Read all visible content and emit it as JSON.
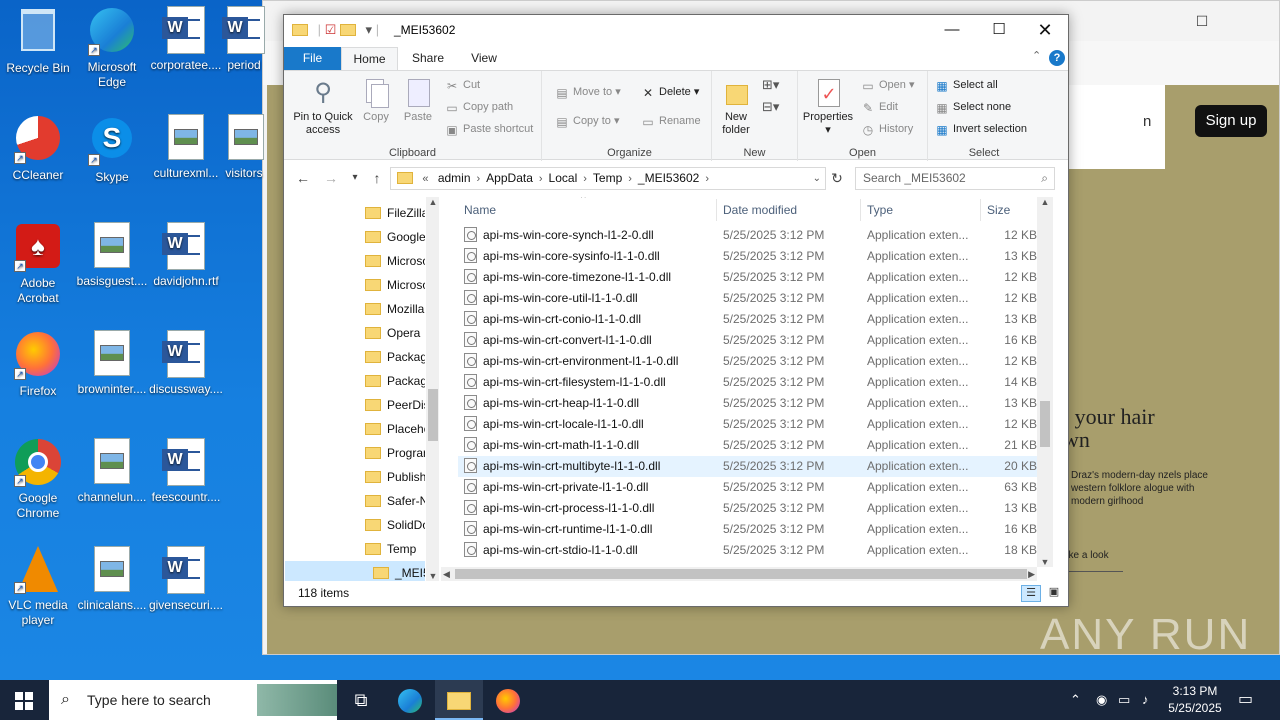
{
  "desktop": {
    "icons": [
      {
        "label": "Recycle Bin",
        "type": "recycle"
      },
      {
        "label": "Microsoft Edge",
        "type": "edge"
      },
      {
        "label": "corporatee....",
        "type": "word"
      },
      {
        "label": "period",
        "type": "word"
      },
      {
        "label": "CCleaner",
        "type": "ccleaner"
      },
      {
        "label": "Skype",
        "type": "skype"
      },
      {
        "label": "culturexml...",
        "type": "image"
      },
      {
        "label": "visitors",
        "type": "image"
      },
      {
        "label": "Adobe Acrobat",
        "type": "acrobat"
      },
      {
        "label": "basisguest....",
        "type": "image"
      },
      {
        "label": "davidjohn.rtf",
        "type": "word"
      },
      {
        "label": "Firefox",
        "type": "firefox"
      },
      {
        "label": "browninter....",
        "type": "image"
      },
      {
        "label": "discussway....",
        "type": "word"
      },
      {
        "label": "Google Chrome",
        "type": "chrome"
      },
      {
        "label": "channelun....",
        "type": "image"
      },
      {
        "label": "feescountr....",
        "type": "word"
      },
      {
        "label": "VLC media player",
        "type": "vlc"
      },
      {
        "label": "clinicalans....",
        "type": "image"
      },
      {
        "label": "givensecuri....",
        "type": "word"
      }
    ]
  },
  "browser": {
    "signup_label": "Sign up",
    "partial_link": "n",
    "hero_title_1": "t your hair",
    "hero_title_2": "wn",
    "hero_sub": "Draz's modern-day nzels place western folklore alogue with modern girlhood",
    "take_look": "ake a look"
  },
  "explorer": {
    "title": "_MEI53602",
    "tabs": {
      "file": "File",
      "home": "Home",
      "share": "Share",
      "view": "View"
    },
    "ribbon": {
      "clipboard": {
        "label": "Clipboard",
        "pin": "Pin to Quick access",
        "copy": "Copy",
        "paste": "Paste",
        "cut": "Cut",
        "copy_path": "Copy path",
        "paste_shortcut": "Paste shortcut"
      },
      "organize": {
        "label": "Organize",
        "move_to": "Move to",
        "copy_to": "Copy to",
        "delete": "Delete",
        "rename": "Rename"
      },
      "new": {
        "label": "New",
        "new_folder": "New folder"
      },
      "open": {
        "label": "Open",
        "properties": "Properties",
        "open": "Open",
        "edit": "Edit",
        "history": "History"
      },
      "select": {
        "label": "Select",
        "select_all": "Select all",
        "select_none": "Select none",
        "invert": "Invert selection"
      }
    },
    "address": {
      "prefix": "«",
      "segments": [
        "admin",
        "AppData",
        "Local",
        "Temp",
        "_MEI53602"
      ]
    },
    "search_placeholder": "Search _MEI53602",
    "nav_items": [
      {
        "label": "FileZilla"
      },
      {
        "label": "Google"
      },
      {
        "label": "Microso"
      },
      {
        "label": "Microso"
      },
      {
        "label": "Mozilla"
      },
      {
        "label": "Opera"
      },
      {
        "label": "Packag"
      },
      {
        "label": "Packag"
      },
      {
        "label": "PeerDis"
      },
      {
        "label": "Placeho"
      },
      {
        "label": "Progran"
      },
      {
        "label": "Publish"
      },
      {
        "label": "Safer-N"
      },
      {
        "label": "SolidDo"
      },
      {
        "label": "Temp"
      },
      {
        "label": "_MEI5"
      }
    ],
    "columns": {
      "name": "Name",
      "date": "Date modified",
      "type": "Type",
      "size": "Size"
    },
    "files": [
      {
        "name": "api-ms-win-core-synch-l1-2-0.dll",
        "date": "5/25/2025 3:12 PM",
        "type": "Application exten...",
        "size": "12 KB"
      },
      {
        "name": "api-ms-win-core-sysinfo-l1-1-0.dll",
        "date": "5/25/2025 3:12 PM",
        "type": "Application exten...",
        "size": "13 KB"
      },
      {
        "name": "api-ms-win-core-timezone-l1-1-0.dll",
        "date": "5/25/2025 3:12 PM",
        "type": "Application exten...",
        "size": "12 KB"
      },
      {
        "name": "api-ms-win-core-util-l1-1-0.dll",
        "date": "5/25/2025 3:12 PM",
        "type": "Application exten...",
        "size": "12 KB"
      },
      {
        "name": "api-ms-win-crt-conio-l1-1-0.dll",
        "date": "5/25/2025 3:12 PM",
        "type": "Application exten...",
        "size": "13 KB"
      },
      {
        "name": "api-ms-win-crt-convert-l1-1-0.dll",
        "date": "5/25/2025 3:12 PM",
        "type": "Application exten...",
        "size": "16 KB"
      },
      {
        "name": "api-ms-win-crt-environment-l1-1-0.dll",
        "date": "5/25/2025 3:12 PM",
        "type": "Application exten...",
        "size": "12 KB"
      },
      {
        "name": "api-ms-win-crt-filesystem-l1-1-0.dll",
        "date": "5/25/2025 3:12 PM",
        "type": "Application exten...",
        "size": "14 KB"
      },
      {
        "name": "api-ms-win-crt-heap-l1-1-0.dll",
        "date": "5/25/2025 3:12 PM",
        "type": "Application exten...",
        "size": "13 KB"
      },
      {
        "name": "api-ms-win-crt-locale-l1-1-0.dll",
        "date": "5/25/2025 3:12 PM",
        "type": "Application exten...",
        "size": "12 KB"
      },
      {
        "name": "api-ms-win-crt-math-l1-1-0.dll",
        "date": "5/25/2025 3:12 PM",
        "type": "Application exten...",
        "size": "21 KB"
      },
      {
        "name": "api-ms-win-crt-multibyte-l1-1-0.dll",
        "date": "5/25/2025 3:12 PM",
        "type": "Application exten...",
        "size": "20 KB",
        "highlighted": true
      },
      {
        "name": "api-ms-win-crt-private-l1-1-0.dll",
        "date": "5/25/2025 3:12 PM",
        "type": "Application exten...",
        "size": "63 KB"
      },
      {
        "name": "api-ms-win-crt-process-l1-1-0.dll",
        "date": "5/25/2025 3:12 PM",
        "type": "Application exten...",
        "size": "13 KB"
      },
      {
        "name": "api-ms-win-crt-runtime-l1-1-0.dll",
        "date": "5/25/2025 3:12 PM",
        "type": "Application exten...",
        "size": "16 KB"
      },
      {
        "name": "api-ms-win-crt-stdio-l1-1-0.dll",
        "date": "5/25/2025 3:12 PM",
        "type": "Application exten...",
        "size": "18 KB"
      }
    ],
    "status": "118 items"
  },
  "taskbar": {
    "search_placeholder": "Type here to search",
    "time": "3:13 PM",
    "date": "5/25/2025"
  },
  "watermark": "ANY RUN",
  "colors": {
    "accent": "#1979ca",
    "taskbar": "#18253a",
    "desktop": "#1573d6",
    "selection": "#cce8ff"
  }
}
